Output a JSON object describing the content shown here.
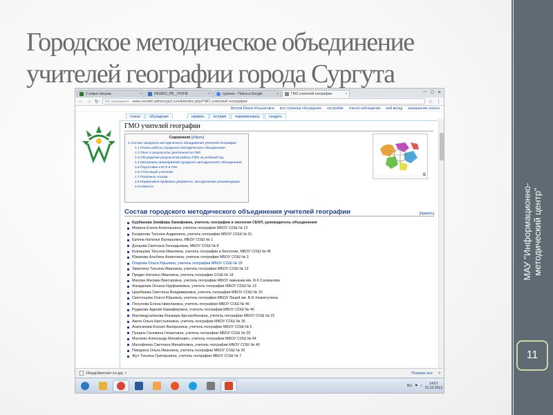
{
  "slide": {
    "title": "Городское методическое объединение учителей географии города Сургута",
    "side_label_line1": "МАУ \"Информационно-",
    "side_label_line2": "методический центр\"",
    "slide_number": "11"
  },
  "browser": {
    "tabs": [
      {
        "label": "2 новых письма",
        "color": "#2a7a2a"
      },
      {
        "label": "НЕ09ЕЗ_РВ_ | РОНЕ",
        "color": "#3a6fc4"
      },
      {
        "label": "сургеин - Поиск в Google",
        "color": "#4285f4"
      },
      {
        "label": "ГМО учителей географии",
        "color": "#8a8a8a"
      }
    ],
    "window_controls": [
      "—",
      "☐",
      "✕"
    ],
    "url_security": "Не защищено",
    "url": "www.surwiki.admsurgut.ru/wiki/index.php/ГМО учителей географии",
    "user_links": [
      "Ветров Мазия Ильшатовна",
      "вся страница обсуждения",
      "настройки",
      "список наблюдения",
      "мой вклад",
      "завершение сеанса"
    ],
    "wiki_tabs": [
      "статья",
      "обсуждение",
      "править",
      "история",
      "переименовать",
      "следить"
    ]
  },
  "wiki": {
    "page_title": "ГМО учителей географии",
    "toc_title": "Содержание",
    "toc_hide": "[убрать]",
    "toc_items": [
      {
        "text": "1 Состав городского методического объединения учителей географии",
        "sub": false
      },
      {
        "text": "1.1 Планы работы городского методического объединения",
        "sub": true
      },
      {
        "text": "1.2 Опыт о результатах деятельности ГМО",
        "sub": true
      },
      {
        "text": "1.3 Обсуждение результатов работы ГМО за учебный год",
        "sub": true
      },
      {
        "text": "1.4 Материалы мероприятий городского методического объединения",
        "sub": true
      },
      {
        "text": "1.5 Подготовка к ЕГЭ и ГИА",
        "sub": true
      },
      {
        "text": "1.6 Аттестация учителей",
        "sub": true
      },
      {
        "text": "1.7 Полезные ссылки",
        "sub": true
      },
      {
        "text": "1.8 Нормативно-правовые документы, методические рекомендации",
        "sub": true
      },
      {
        "text": "1.9 Новости",
        "sub": true
      }
    ],
    "section_heading": "Состав городского методического объединения учителей географии",
    "section_edit": "[править]",
    "members": [
      {
        "text": "Курбанова Зимфира Ханифовна, учитель географии и экологии СЕНЛ, руководитель объединения",
        "kind": "first"
      },
      {
        "text": "Мерина Елена Анатольевна, учитель географии МБОУ СОШ № 12",
        "kind": "normal"
      },
      {
        "text": "Богданова Татьяна Андреевна, учитель географии МБОУ СОШ № 31",
        "kind": "normal"
      },
      {
        "text": "Ертина Наталья Валерьевна, МБОУ СОШ № 1",
        "kind": "normal"
      },
      {
        "text": "Донцова Светлана Геннадьевна, МБОУ СОШ № 8",
        "kind": "normal"
      },
      {
        "text": "Кузнецова Татьяна Ивановна, учитель географии и биологии, МБОУ СОШ № 45",
        "kind": "normal"
      },
      {
        "text": "Юмакова Альбина Ахметовна, учитель географии МБОУ СОШ № 3",
        "kind": "normal"
      },
      {
        "text": "Опарова Ольга Юрьевна, учитель географии МБОУ СОШ № 18",
        "kind": "link"
      },
      {
        "text": "Замятина Татьяна Ивановна, учитель географии МБОУ СОШ № 13",
        "kind": "normal"
      },
      {
        "text": "Прядко Наталья Ивановна, учитель географии СОШ № 18",
        "kind": "normal"
      },
      {
        "text": "Махова Жасмин Викторовна, учитель географии МБОУ гимназии им. Ф.К.Салманова",
        "kind": "normal"
      },
      {
        "text": "Фахрдеева Оксана Нурфаизовна, учитель географии МБОУ СОШ № 13",
        "kind": "normal"
      },
      {
        "text": "Церябаева Светлана Владимировна, учитель географии МБОУ СОШ № 10",
        "kind": "normal"
      },
      {
        "text": "Светлоцова Олеся Юрьевна, учитель географии МБОУ Лицей им. В.И.Хизметулина",
        "kind": "normal"
      },
      {
        "text": "Полунова Елена Николаевна, учитель географии МБОУ СОШ № 46",
        "kind": "normal"
      },
      {
        "text": "Рудакова Аделия Камаферовна, учитель географии МБОУ СОШ № 4б",
        "kind": "normal"
      },
      {
        "text": "Магомедсалихова Ильмира Арсланбековна, учитель географии МБОУ СОШ № 22",
        "kind": "normal"
      },
      {
        "text": "Акита Ольга Крестьяновна, учитель географии МБОУ СОШ № 35",
        "kind": "normal"
      },
      {
        "text": "Асвоганова Ксения Валерьевна, учитель географии МБОУ СОШ № 5",
        "kind": "normal"
      },
      {
        "text": "Пушина Гасемина Гиззатовна, учитель географии МБОУ СОШ № 29",
        "kind": "normal"
      },
      {
        "text": "Малянко Александр Михайлович, учитель географии МБОУ СОШ № 44",
        "kind": "normal"
      },
      {
        "text": "Малофеева Светлана Михайловна, учитель географии МБОУ СОШ № 46",
        "kind": "normal"
      },
      {
        "text": "Пикарина Ольга Ивановна, учитель географии МБОУ СОШ № 26",
        "kind": "normal"
      },
      {
        "text": "Жуч Татьяна Григорьевна, учитель географии МБОУ СОШ № 7",
        "kind": "normal"
      }
    ]
  },
  "download_bar": {
    "file_name": "24ордн3ватлант ico.jpg",
    "show_all": "Показать все",
    "close": "✕"
  },
  "taskbar": {
    "apps": [
      {
        "name": "start",
        "color": "#2f78c4"
      },
      {
        "name": "explorer",
        "color": "#e6b341"
      },
      {
        "name": "chrome",
        "color": "#db4437"
      },
      {
        "name": "word",
        "color": "#2b5797"
      },
      {
        "name": "mail",
        "color": "#f2a34c"
      },
      {
        "name": "browser",
        "color": "#e95420"
      },
      {
        "name": "skype",
        "color": "#1ba1e2"
      },
      {
        "name": "media",
        "color": "#7a7a7a"
      },
      {
        "name": "powerpoint",
        "color": "#d24726"
      }
    ],
    "lang": "RU",
    "time": "14:57",
    "date": "01.10.2013"
  }
}
